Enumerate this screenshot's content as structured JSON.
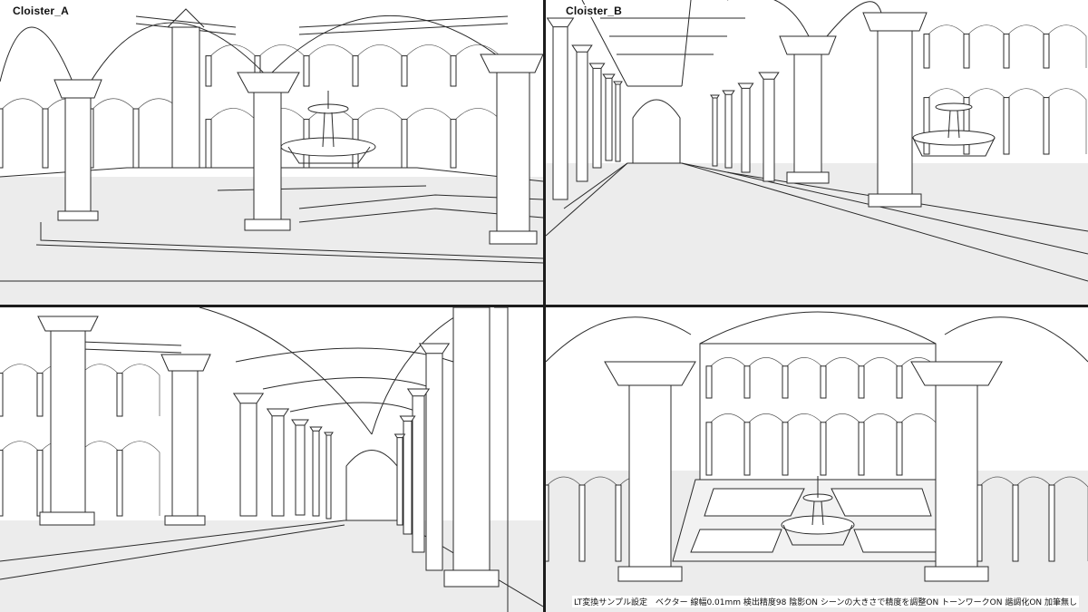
{
  "panels": [
    {
      "label": "Cloister_A"
    },
    {
      "label": "Cloister_B"
    },
    {
      "label": ""
    },
    {
      "label": ""
    }
  ],
  "caption": "LT変換サンプル設定　ベクター 線幅0.01mm 検出精度98 陰影ON シーンの大きさで精度を調整ON トーンワークON 諧調化ON 加筆無し",
  "colors": {
    "divider": "#1c1c1c",
    "line": "#2a2a2a",
    "background": "#ffffff"
  }
}
